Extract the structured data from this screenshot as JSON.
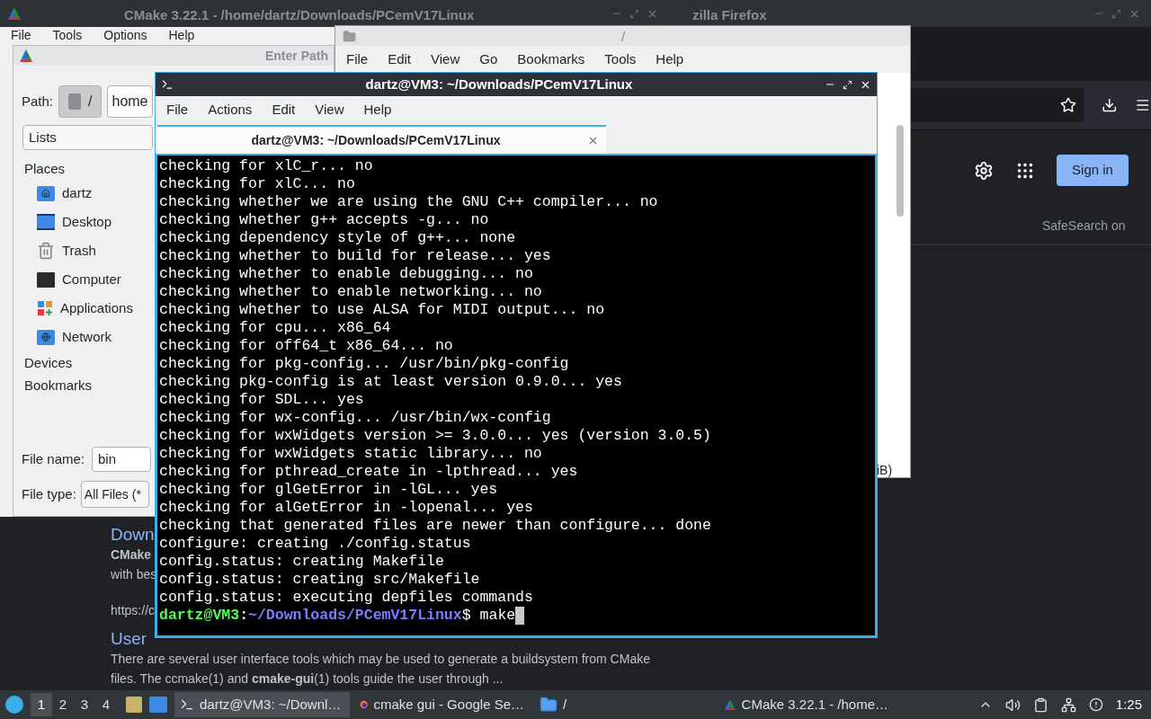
{
  "cmake_window": {
    "title": "CMake 3.22.1 - /home/dartz/Downloads/PCemV17Linux",
    "menu": [
      "File",
      "Tools",
      "Options",
      "Help"
    ]
  },
  "firefox_window": {
    "title": "zilla Firefox",
    "sign_in": "Sign in",
    "safesearch": "SafeSearch on",
    "results": [
      {
        "kind": "link",
        "text": "Down"
      },
      {
        "kind": "bold",
        "text": "CMake"
      },
      {
        "kind": "text",
        "text": "with bes"
      },
      {
        "kind": "url",
        "text": "https://c"
      },
      {
        "kind": "link",
        "text": "User"
      },
      {
        "kind": "text",
        "text": "There are several user interface tools which may be used to generate a buildsystem from CMake"
      },
      {
        "kind": "text",
        "text": "files. The ccmake(1) and **cmake-gui**(1) tools guide the user through ..."
      }
    ]
  },
  "file_dialog": {
    "title": "Enter Path",
    "path_label": "Path:",
    "path_buttons": [
      {
        "label": "/",
        "selected": true
      },
      {
        "label": "home",
        "selected": false
      }
    ],
    "view": "Lists",
    "places_heading": "Places",
    "places": [
      {
        "label": "dartz",
        "kind": "home"
      },
      {
        "label": "Desktop",
        "kind": "desktop"
      },
      {
        "label": "Trash",
        "kind": "trash"
      },
      {
        "label": "Computer",
        "kind": "computer"
      },
      {
        "label": "Applications",
        "kind": "apps"
      },
      {
        "label": "Network",
        "kind": "network"
      }
    ],
    "sections": [
      "Devices",
      "Bookmarks"
    ],
    "file_name_label": "File name:",
    "file_name": "bin",
    "file_type_label": "File type:",
    "file_type": "All Files (*"
  },
  "file_manager": {
    "title": "/",
    "menu": [
      "File",
      "Edit",
      "View",
      "Go",
      "Bookmarks",
      "Tools",
      "Help"
    ],
    "status": "iB)"
  },
  "terminal": {
    "title": "dartz@VM3: ~/Downloads/PCemV17Linux",
    "menu": [
      "File",
      "Actions",
      "Edit",
      "View",
      "Help"
    ],
    "tab": "dartz@VM3: ~/Downloads/PCemV17Linux",
    "lines": [
      "checking for xlC_r... no",
      "checking for xlC... no",
      "checking whether we are using the GNU C++ compiler... no",
      "checking whether g++ accepts -g... no",
      "checking dependency style of g++... none",
      "checking whether to build for release... yes",
      "checking whether to enable debugging... no",
      "checking whether to enable networking... no",
      "checking whether to use ALSA for MIDI output... no",
      "checking for cpu... x86_64",
      "checking for off64_t x86_64... no",
      "checking for pkg-config... /usr/bin/pkg-config",
      "checking pkg-config is at least version 0.9.0... yes",
      "checking for SDL... yes",
      "checking for wx-config... /usr/bin/wx-config",
      "checking for wxWidgets version >= 3.0.0... yes (version 3.0.5)",
      "checking for wxWidgets static library... no",
      "checking for pthread_create in -lpthread... yes",
      "checking for glGetError in -lGL... yes",
      "checking for alGetError in -lopenal... yes",
      "checking that generated files are newer than configure... done",
      "configure: creating ./config.status",
      "config.status: creating Makefile",
      "config.status: creating src/Makefile",
      "config.status: executing depfiles commands"
    ],
    "prompt": {
      "user": "dartz@VM3",
      "sep": ":",
      "path": "~/Downloads/PCemV17Linux",
      "symbol": "$",
      "command": "make"
    }
  },
  "taskbar": {
    "workspaces": [
      {
        "label": "1",
        "selected": true
      },
      {
        "label": "2",
        "selected": false
      },
      {
        "label": "3",
        "selected": false
      },
      {
        "label": "4",
        "selected": false
      }
    ],
    "tasks": [
      {
        "label": "dartz@VM3: ~/Downl…",
        "kind": "terminal",
        "selected": true
      },
      {
        "label": "cmake gui - Google Se…",
        "kind": "firefox",
        "selected": false
      },
      {
        "label": "/",
        "kind": "folder",
        "selected": false
      },
      {
        "label": "CMake 3.22.1 - /home…",
        "kind": "cmake",
        "selected": false
      }
    ],
    "clock": "1:25"
  }
}
